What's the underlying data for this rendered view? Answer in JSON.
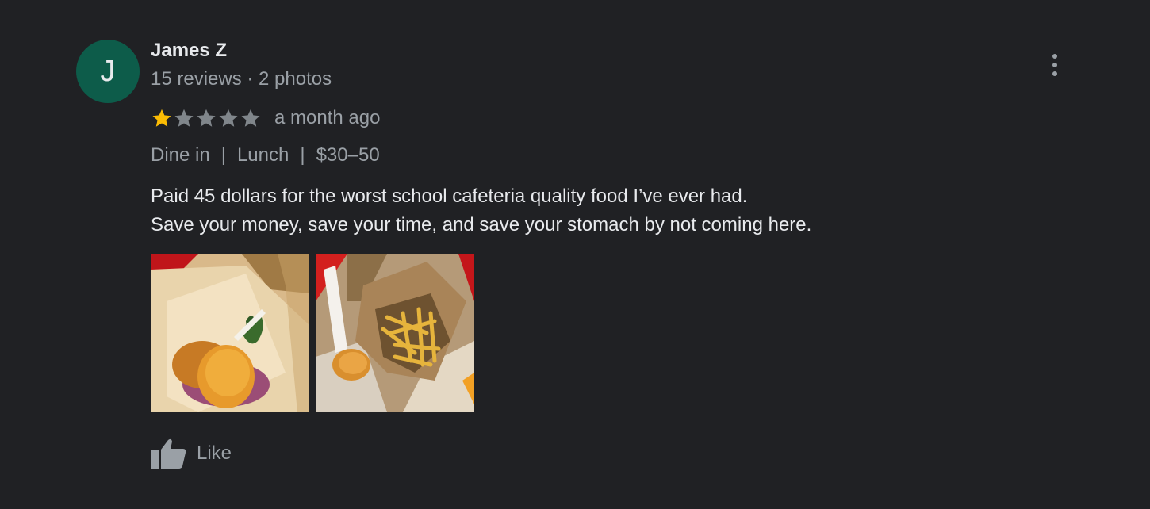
{
  "review": {
    "author": {
      "initial": "J",
      "name": "James Z",
      "meta": "15 reviews · 2 photos",
      "avatar_color": "#0d5c4a"
    },
    "rating": {
      "value": 1,
      "max": 5,
      "filled_color": "#fbbc04",
      "empty_color": "#80868b"
    },
    "time_ago": "a month ago",
    "tags": [
      "Dine in",
      "Lunch",
      "$30–50"
    ],
    "tag_separator": "|",
    "text_lines": [
      "Paid 45 dollars for the worst school cafeteria quality food I’ve ever had.",
      "Save your money, save your time, and save your stomach by not coming here."
    ],
    "photos": [
      {
        "name": "review-photo-burger"
      },
      {
        "name": "review-photo-fries"
      }
    ],
    "like_label": "Like",
    "more_icon": "more-vert-icon"
  }
}
